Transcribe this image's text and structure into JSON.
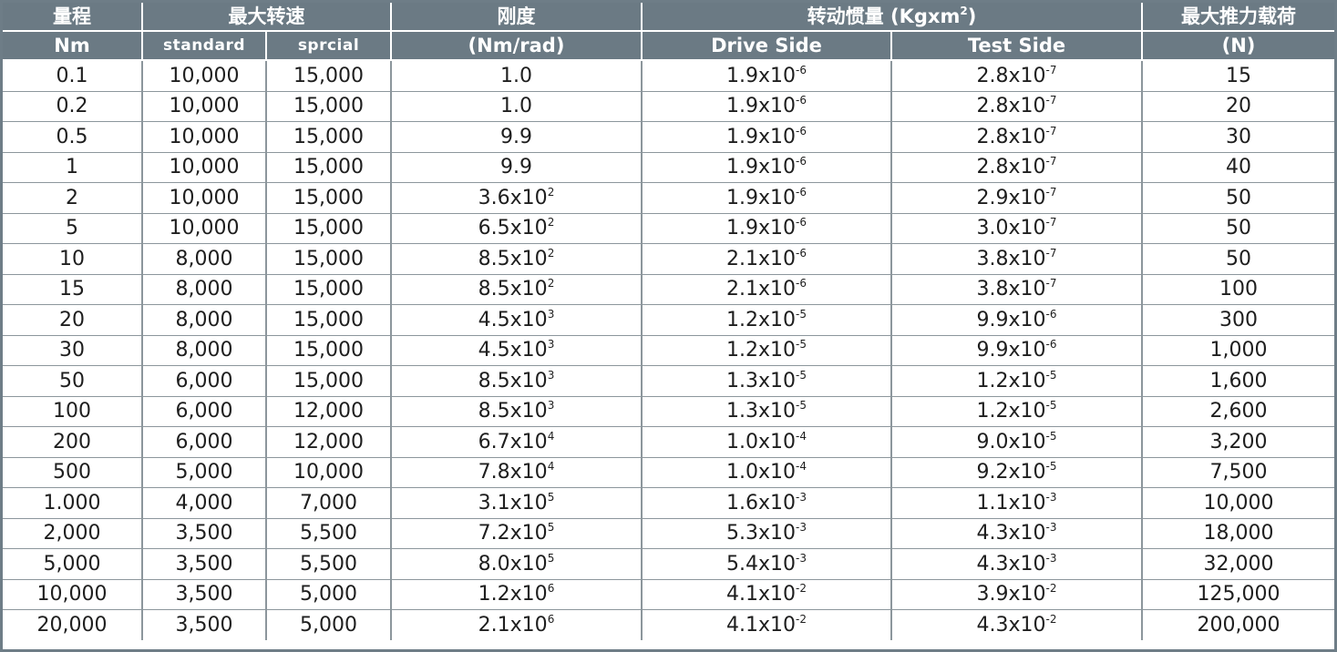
{
  "header": {
    "range": {
      "cn": "量程",
      "unit": "Nm"
    },
    "max_speed": {
      "cn": "最大转速",
      "standard": "standard",
      "special": "sprcial"
    },
    "stiffness": {
      "cn": "刚度",
      "unit": "(Nm/rad)"
    },
    "inertia": {
      "cn": "转动惯量 (Kgxm",
      "sup": "2",
      "close": ")",
      "drive": "Drive Side",
      "test": "Test Side"
    },
    "thrust": {
      "cn": "最大推力载荷",
      "unit": "(N)"
    }
  },
  "rows": [
    {
      "range": "0.1",
      "std": "10,000",
      "spc": "15,000",
      "k": "1.0",
      "k_exp": "",
      "dm": "1.9x10",
      "de": "-6",
      "tm": "2.8x10",
      "te": "-7",
      "thrust": "15"
    },
    {
      "range": "0.2",
      "std": "10,000",
      "spc": "15,000",
      "k": "1.0",
      "k_exp": "",
      "dm": "1.9x10",
      "de": "-6",
      "tm": "2.8x10",
      "te": "-7",
      "thrust": "20"
    },
    {
      "range": "0.5",
      "std": "10,000",
      "spc": "15,000",
      "k": "9.9",
      "k_exp": "",
      "dm": "1.9x10",
      "de": "-6",
      "tm": "2.8x10",
      "te": "-7",
      "thrust": "30"
    },
    {
      "range": "1",
      "std": "10,000",
      "spc": "15,000",
      "k": "9.9",
      "k_exp": "",
      "dm": "1.9x10",
      "de": "-6",
      "tm": "2.8x10",
      "te": "-7",
      "thrust": "40"
    },
    {
      "range": "2",
      "std": "10,000",
      "spc": "15,000",
      "k": "3.6x10",
      "k_exp": "2",
      "dm": "1.9x10",
      "de": "-6",
      "tm": "2.9x10",
      "te": "-7",
      "thrust": "50"
    },
    {
      "range": "5",
      "std": "10,000",
      "spc": "15,000",
      "k": "6.5x10",
      "k_exp": "2",
      "dm": "1.9x10",
      "de": "-6",
      "tm": "3.0x10",
      "te": "-7",
      "thrust": "50"
    },
    {
      "range": "10",
      "std": "8,000",
      "spc": "15,000",
      "k": "8.5x10",
      "k_exp": "2",
      "dm": "2.1x10",
      "de": "-6",
      "tm": "3.8x10",
      "te": "-7",
      "thrust": "50"
    },
    {
      "range": "15",
      "std": "8,000",
      "spc": "15,000",
      "k": "8.5x10",
      "k_exp": "2",
      "dm": "2.1x10",
      "de": "-6",
      "tm": "3.8x10",
      "te": "-7",
      "thrust": "100"
    },
    {
      "range": "20",
      "std": "8,000",
      "spc": "15,000",
      "k": "4.5x10",
      "k_exp": "3",
      "dm": "1.2x10",
      "de": "-5",
      "tm": "9.9x10",
      "te": "-6",
      "thrust": "300"
    },
    {
      "range": "30",
      "std": "8,000",
      "spc": "15,000",
      "k": "4.5x10",
      "k_exp": "3",
      "dm": "1.2x10",
      "de": "-5",
      "tm": "9.9x10",
      "te": "-6",
      "thrust": "1,000"
    },
    {
      "range": "50",
      "std": "6,000",
      "spc": "15,000",
      "k": "8.5x10",
      "k_exp": "3",
      "dm": "1.3x10",
      "de": "-5",
      "tm": "1.2x10",
      "te": "-5",
      "thrust": "1,600"
    },
    {
      "range": "100",
      "std": "6,000",
      "spc": "12,000",
      "k": "8.5x10",
      "k_exp": "3",
      "dm": "1.3x10",
      "de": "-5",
      "tm": "1.2x10",
      "te": "-5",
      "thrust": "2,600"
    },
    {
      "range": "200",
      "std": "6,000",
      "spc": "12,000",
      "k": "6.7x10",
      "k_exp": "4",
      "dm": "1.0x10",
      "de": "-4",
      "tm": "9.0x10",
      "te": "-5",
      "thrust": "3,200"
    },
    {
      "range": "500",
      "std": "5,000",
      "spc": "10,000",
      "k": "7.8x10",
      "k_exp": "4",
      "dm": "1.0x10",
      "de": "-4",
      "tm": "9.2x10",
      "te": "-5",
      "thrust": "7,500"
    },
    {
      "range": "1.000",
      "std": "4,000",
      "spc": "7,000",
      "k": "3.1x10",
      "k_exp": "5",
      "dm": "1.6x10",
      "de": "-3",
      "tm": "1.1x10",
      "te": "-3",
      "thrust": "10,000"
    },
    {
      "range": "2,000",
      "std": "3,500",
      "spc": "5,500",
      "k": "7.2x10",
      "k_exp": "5",
      "dm": "5.3x10",
      "de": "-3",
      "tm": "4.3x10",
      "te": "-3",
      "thrust": "18,000"
    },
    {
      "range": "5,000",
      "std": "3,500",
      "spc": "5,500",
      "k": "8.0x10",
      "k_exp": "5",
      "dm": "5.4x10",
      "de": "-3",
      "tm": "4.3x10",
      "te": "-3",
      "thrust": "32,000"
    },
    {
      "range": "10,000",
      "std": "3,500",
      "spc": "5,000",
      "k": "1.2x10",
      "k_exp": "6",
      "dm": "4.1x10",
      "de": "-2",
      "tm": "3.9x10",
      "te": "-2",
      "thrust": "125,000"
    },
    {
      "range": "20,000",
      "std": "3,500",
      "spc": "5,000",
      "k": "2.1x10",
      "k_exp": "6",
      "dm": "4.1x10",
      "de": "-2",
      "tm": "4.3x10",
      "te": "-2",
      "thrust": "200,000"
    }
  ]
}
